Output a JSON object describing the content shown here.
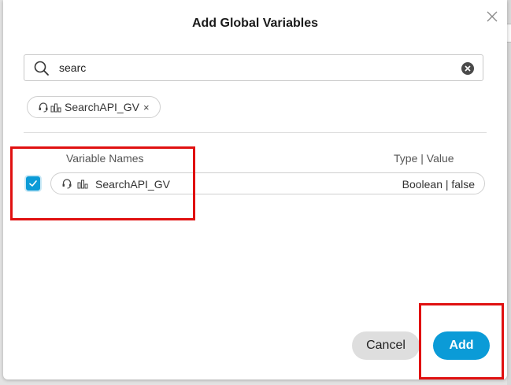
{
  "dialog": {
    "title": "Add Global Variables"
  },
  "search": {
    "value": "searc",
    "placeholder": ""
  },
  "selected_chip": {
    "label": "SearchAPI_GV",
    "remove_glyph": "×"
  },
  "table": {
    "headers": {
      "names": "Variable Names",
      "type_value": "Type | Value"
    },
    "rows": [
      {
        "name": "SearchAPI_GV",
        "type_value": "Boolean | false",
        "checked": true
      }
    ]
  },
  "footer": {
    "cancel_label": "Cancel",
    "add_label": "Add"
  },
  "icons": {
    "close": "close-icon",
    "search": "search-icon",
    "clear": "clear-icon",
    "headset": "headset-icon",
    "analytics": "bar-chart-icon",
    "check": "check-icon"
  },
  "colors": {
    "accent": "#0b9bd7",
    "highlight": "#e01010",
    "cancel_bg": "#dedede"
  }
}
